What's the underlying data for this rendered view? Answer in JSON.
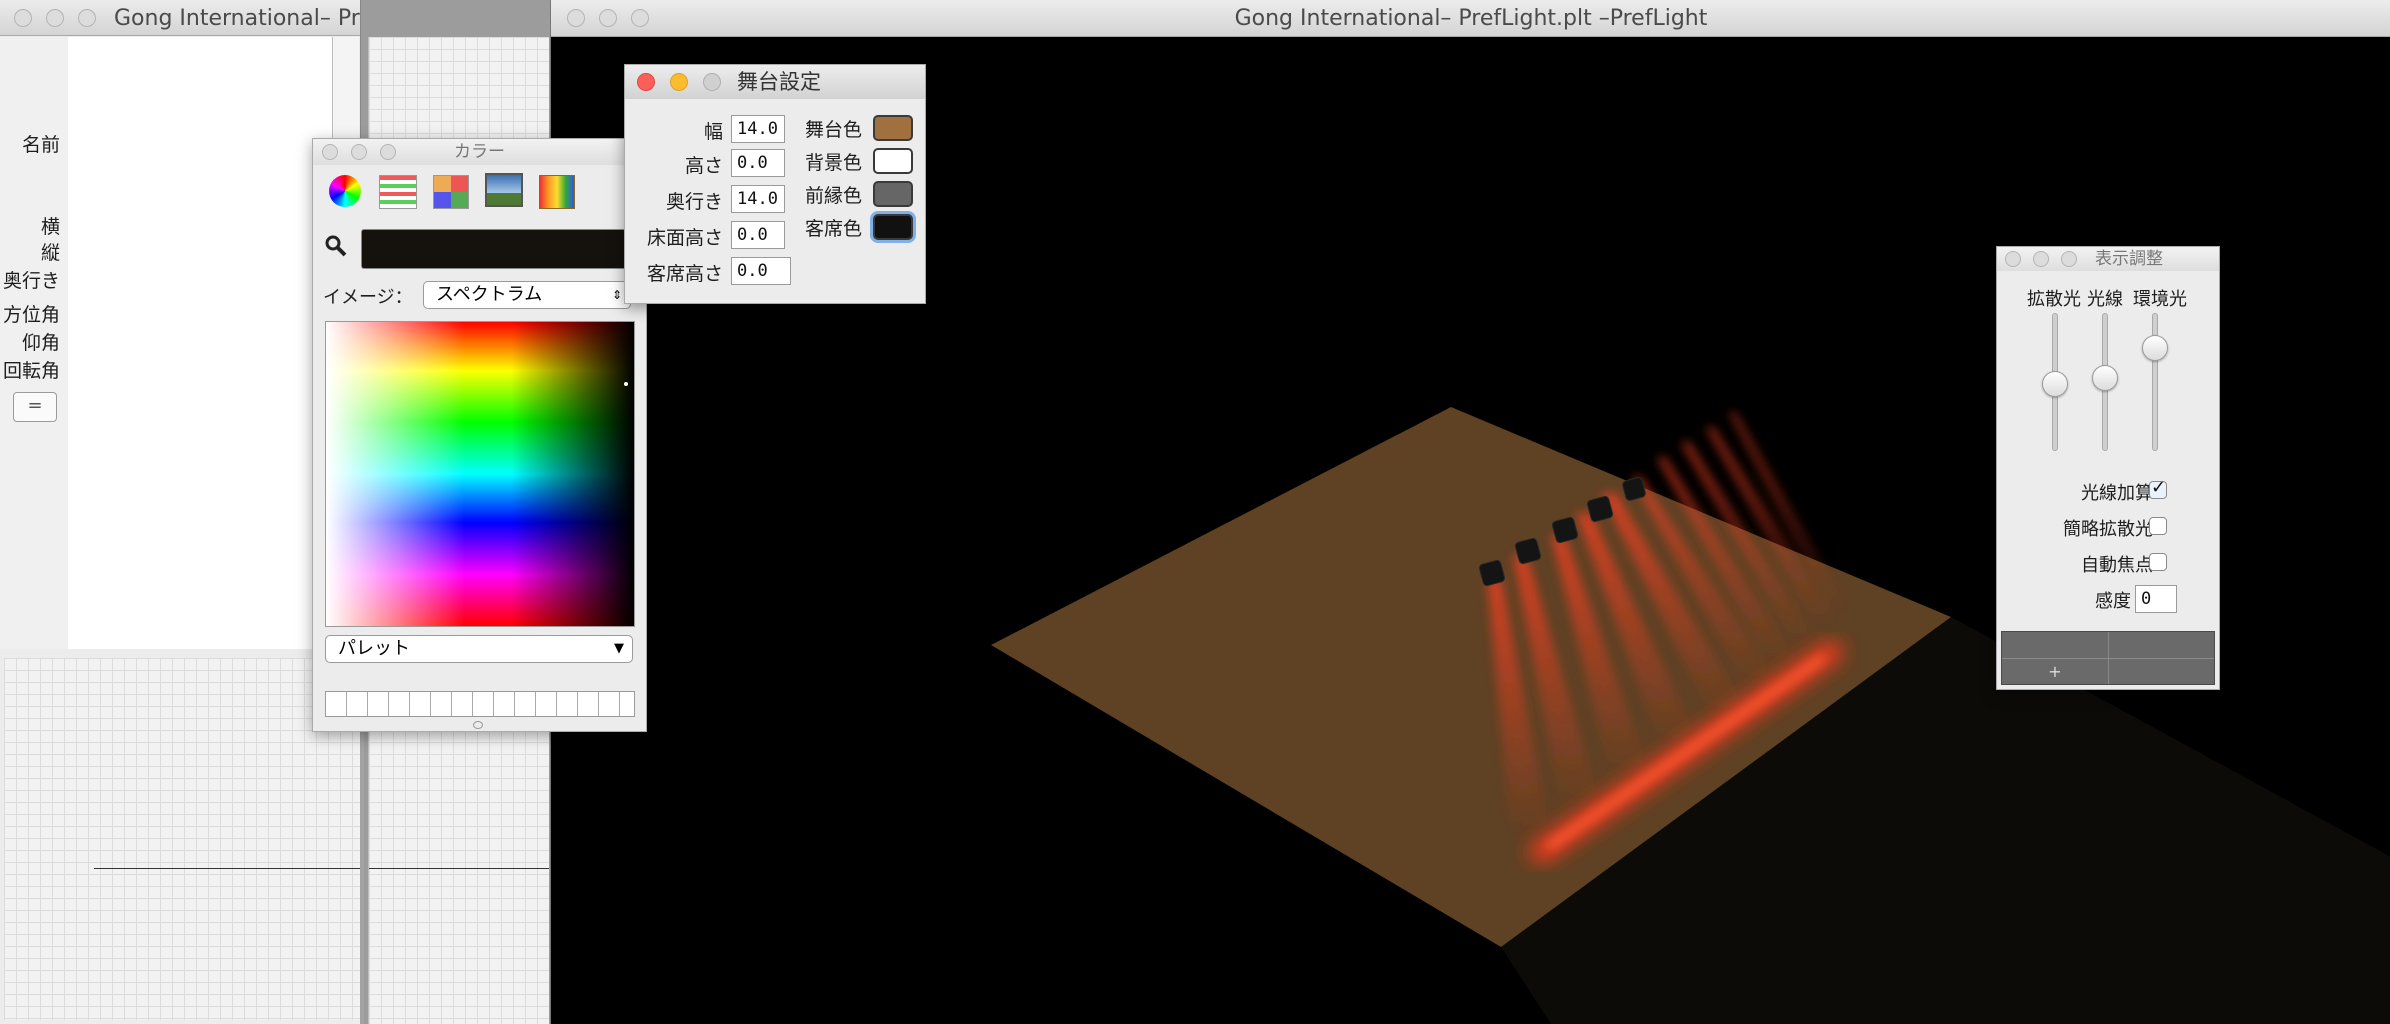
{
  "left_window": {
    "title": "Gong International– PrefLight.plt –Pre...",
    "labels": [
      "名前",
      "横",
      "縦",
      "奥行き",
      "方位角",
      "仰角",
      "回転角"
    ],
    "equals_button": "="
  },
  "main_window": {
    "title": "Gong International– PrefLight.plt –PrefLight"
  },
  "color_panel": {
    "title": "カラー",
    "image_label": "イメージ：",
    "image_select": "スペクトラム",
    "palette_select": "パレット",
    "tab_icons": [
      "color-wheel-icon",
      "color-sliders-icon",
      "color-palettes-icon",
      "image-palettes-icon",
      "crayons-icon"
    ],
    "current_color": "#15110d"
  },
  "stage_settings": {
    "title": "舞台設定",
    "fields": [
      {
        "label": "幅",
        "value": "14.0"
      },
      {
        "label": "高さ",
        "value": "0.0"
      },
      {
        "label": "奥行き",
        "value": "14.0"
      },
      {
        "label": "床面高さ",
        "value": "0.0"
      },
      {
        "label": "客席高さ",
        "value": "0.0"
      }
    ],
    "colors": [
      {
        "label": "舞台色",
        "color": "#a0713e"
      },
      {
        "label": "背景色",
        "color": "#ffffff"
      },
      {
        "label": "前縁色",
        "color": "#666666"
      },
      {
        "label": "客席色",
        "color": "#111111"
      }
    ]
  },
  "display_adjust": {
    "title": "表示調整",
    "slider_labels": [
      "拡散光",
      "光線",
      "環境光"
    ],
    "slider_levels": [
      0.45,
      0.5,
      0.72
    ],
    "checkboxes": [
      {
        "label": "光線加算",
        "checked": true
      },
      {
        "label": "簡略拡散光",
        "checked": false
      },
      {
        "label": "自動焦点",
        "checked": false
      }
    ],
    "sensitivity_label": "感度",
    "sensitivity_value": "0",
    "add_button": "+"
  },
  "scene": {
    "stage_color": "#5f4124",
    "beam_color": "#ff3a1e",
    "background": "#000000"
  }
}
